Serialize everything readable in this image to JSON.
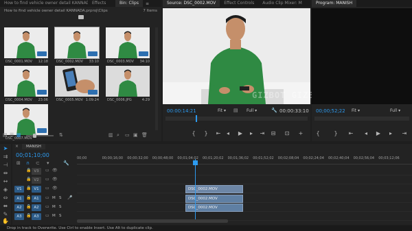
{
  "project_panel": {
    "tabs": [
      "How to find vehicle owner detail KANNADA",
      "Effects",
      "Bin: Clips"
    ],
    "menu_icon": "hamburger-icon",
    "path": "How to find vehicle owner detail KANNADA.prproj\\Clips",
    "item_count": "7 Items",
    "clips": [
      {
        "name": "DSC_0001.MOV",
        "duration": "12:18"
      },
      {
        "name": "DSC_0002.MOV",
        "duration": "33:10"
      },
      {
        "name": "DSC_0003.MOV",
        "duration": "34:10"
      },
      {
        "name": "DSC_0004.MOV",
        "duration": "23:06"
      },
      {
        "name": "DSC_0005.MOV",
        "duration": "1:09:24"
      },
      {
        "name": "DSC_0006.JPG",
        "duration": "4:29"
      },
      {
        "name": "DSC_0007.MOV",
        "duration": ""
      }
    ]
  },
  "source_panel": {
    "tabs": [
      "Source: DSC_0002.MOV",
      "Effect Controls",
      "Audio Clip Mixer: M"
    ],
    "timecode": "00:00:14:21",
    "fit": "Fit",
    "quality": "Full",
    "duration": "00:00:33:10"
  },
  "program_panel": {
    "tab": "Program: MANISH",
    "timecode": "00;00;52;22",
    "fit": "Fit",
    "quality": "Full"
  },
  "watermark": "GIZBOT  GIZBOT  GIZBOT  GIZBO",
  "timeline": {
    "tab": "MANISH",
    "timecode": "00;01;10;00",
    "ruler": [
      "00;00",
      "00;00;16;00",
      "00;00;32;00",
      "00;00;48;00",
      "00;01;04;02",
      "00;01;20;02",
      "00;01;36;02",
      "00;01;52;02",
      "00;02;08;04",
      "00;02;24;04",
      "00;02;40;04",
      "00;02;56;04",
      "00;03;12;06"
    ],
    "tracks": [
      {
        "label": "V3",
        "patch": "",
        "kind": "video"
      },
      {
        "label": "V2",
        "patch": "",
        "kind": "video"
      },
      {
        "label": "V1",
        "patch": "V1",
        "kind": "video"
      },
      {
        "label": "A1",
        "patch": "A1",
        "kind": "audio"
      },
      {
        "label": "A2",
        "patch": "A2",
        "kind": "audio"
      },
      {
        "label": "A3",
        "patch": "A3",
        "kind": "audio"
      }
    ],
    "clips": [
      {
        "track": "V1",
        "name": "DSC_0002.MOV"
      },
      {
        "track": "A1",
        "name": "DSC_0002.MOV"
      },
      {
        "track": "A2",
        "name": "DSC_0002.MOV"
      }
    ],
    "mute_labels": {
      "m": "M",
      "s": "S"
    }
  },
  "status_bar": "Drop in track to Overwrite. Use Ctrl to enable Insert. Use Alt to duplicate clip.",
  "colors": {
    "accent": "#2d9bf0",
    "clip": "#6d86a6",
    "playhead": "#2d9bf0"
  }
}
